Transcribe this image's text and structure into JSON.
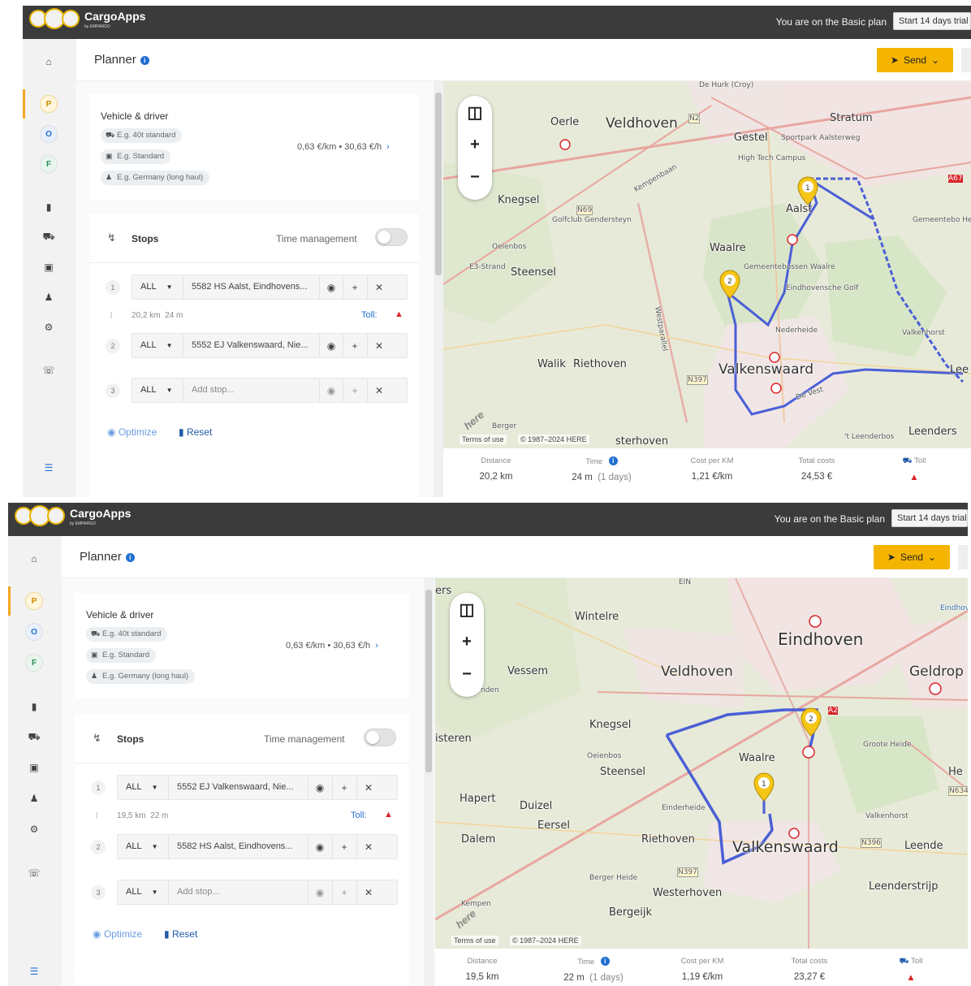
{
  "app": {
    "brand": "CargoApps",
    "brand_sub": "by EMPARGO",
    "plan_text": "You are on the Basic plan",
    "trial_label": "Start 14 days trial"
  },
  "nav": {
    "circles": [
      "P",
      "O",
      "F"
    ]
  },
  "header": {
    "title": "Planner",
    "send_label": "Send"
  },
  "vehicle": {
    "title": "Vehicle & driver",
    "chips": [
      "E.g. 40t standard",
      "E.g. Standard",
      "E.g. Germany (long haul)"
    ],
    "rate": "0,63 €/km • 30,63 €/h"
  },
  "stops_card": {
    "title": "Stops",
    "time_management": "Time management",
    "type_label": "ALL",
    "add_placeholder": "Add stop...",
    "toll_label": "Toll:",
    "optimize_label": "Optimize",
    "reset_label": "Reset"
  },
  "stats_labels": {
    "distance": "Distance",
    "time": "Time",
    "cost_per_km": "Cost per KM",
    "total_costs": "Total costs",
    "toll": "Toll"
  },
  "map_common": {
    "terms": "Terms of use",
    "copyright": "© 1987–2024 HERE",
    "here": "here"
  },
  "screen_a": {
    "stop1": "5582 HS Aalst, Eindhovens...",
    "stop2": "5552 EJ Valkenswaard, Nie...",
    "leg_distance": "20,2 km",
    "leg_time": "24 m",
    "stats": {
      "distance": "20,2 km",
      "time": "24 m",
      "days": "(1 days)",
      "cost_per_km": "1,21 €/km",
      "total_costs": "24,53 €"
    },
    "map_labels": {
      "dehurk": "De Hurk (Croy)",
      "oerle": "Oerle",
      "veldhoven": "Veldhoven",
      "gestel": "Gestel",
      "stratum": "Stratum",
      "sportpark": "Sportpark Aalsterweg",
      "hightech": "High Tech Campus",
      "kempenbaan": "Kempenbaan",
      "knegsel": "Knegsel",
      "golfclub": "Golfclub Gendersteyn",
      "oeienbos": "Oeienbos",
      "aalst": "Aalst",
      "waalre": "Waalre",
      "gemeentebossen": "Gemeentebossen Waalre",
      "eindhovensche": "Eindhovensche Golf",
      "steensel": "Steensel",
      "e3strand": "E3-Strand",
      "westparallel": "Westparallel",
      "nederheide": "Nederheide",
      "valkenhorst": "Valkenhorst",
      "walik": "Walik",
      "riethoven": "Riethoven",
      "valkenswaard": "Valkenswaard",
      "lee": "Lee",
      "devest": "De Vest",
      "berger": "Berger",
      "sterhoven": "sterhoven",
      "leenderbos": "'t Leenderbos",
      "leenders": "Leenders",
      "gemeentebo": "Gemeentebo Heeze",
      "n2": "N2",
      "a67": "A67",
      "n69": "N69",
      "n397": "N397",
      "n69b": "N69"
    }
  },
  "screen_b": {
    "stop1": "5552 EJ Valkenswaard, Nie...",
    "stop2": "5582 HS Aalst, Eindhovens...",
    "leg_distance": "19,5 km",
    "leg_time": "22 m",
    "stats": {
      "distance": "19,5 km",
      "time": "22 m",
      "days": "(1 days)",
      "cost_per_km": "1,19 €/km",
      "total_costs": "23,27 €"
    },
    "map_labels": {
      "ers": "ers",
      "ein": "EIN",
      "wintelre": "Wintelre",
      "eindhoven": "Eindhoven",
      "eindhovenk": "Eindhov Kana",
      "vessem": "Vessem",
      "veldhoven": "Veldhoven",
      "geldrop": "Geldrop",
      "nden": "nden",
      "knegsel": "Knegsel",
      "isteren": "isteren",
      "oeienbos": "Oeienbos",
      "steensel": "Steensel",
      "waalre": "Waalre",
      "grooteheide": "Groote Heide",
      "hapert": "Hapert",
      "duizel": "Duizel",
      "eersel": "Eersel",
      "einderheide": "Einderheide",
      "valkenhorst": "Valkenhorst",
      "dalem": "Dalem",
      "riethoven": "Riethoven",
      "valkenswaard": "Valkenswaard",
      "leende": "Leende",
      "bergerheide": "Berger Heide",
      "westerhoven": "Westerhoven",
      "leenderstrijp": "Leenderstrijp",
      "kempen": "Kempen",
      "bergeijk": "Bergeijk",
      "he": "He",
      "a2": "A2",
      "n396": "N396",
      "n397": "N397",
      "n634": "N634"
    }
  },
  "colors": {
    "topbar": "#3b3b3b",
    "accent": "#f5b400",
    "route": "#4a5fd6",
    "link": "#1f6fd1",
    "danger": "#d9262c"
  },
  "icons": {
    "home": "home-icon",
    "bookmark": "bookmark-icon",
    "truck": "truck-icon",
    "trailer": "trailer-icon",
    "users": "users-icon",
    "settings": "gear-icon",
    "support": "headset-icon",
    "expand": "expand-icon",
    "layers": "layers-icon",
    "pin": "pin-icon",
    "plus": "plus-icon",
    "close": "close-icon",
    "warning": "warning-icon",
    "info": "info-icon"
  }
}
